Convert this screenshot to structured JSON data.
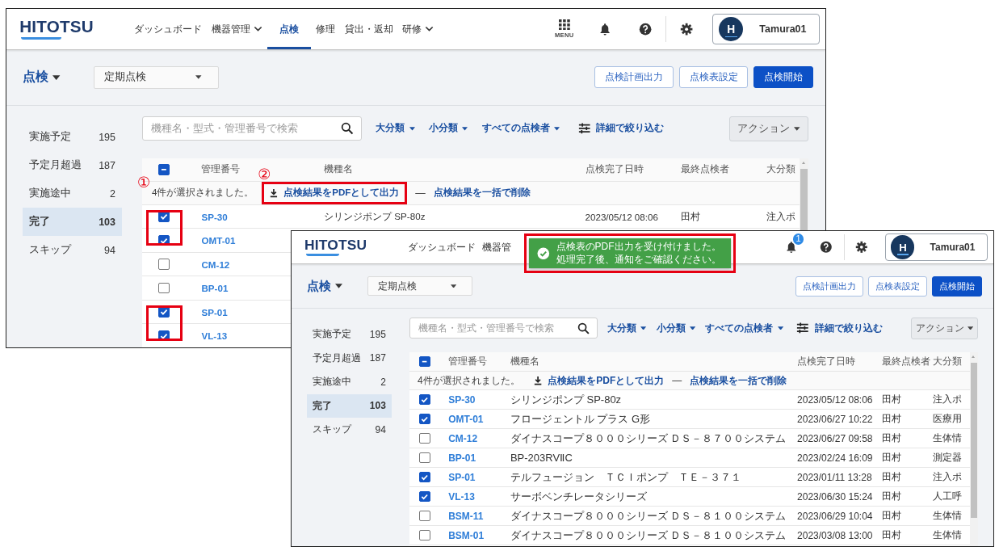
{
  "windows": [
    {
      "logo": "HITOTSU",
      "nav": [
        {
          "label": "ダッシュボード",
          "selected": false,
          "dropdown": false
        },
        {
          "label": "機器管理",
          "selected": false,
          "dropdown": true
        },
        {
          "label": "点検",
          "selected": true,
          "dropdown": false
        },
        {
          "label": "修理",
          "selected": false,
          "dropdown": false
        },
        {
          "label": "貸出・返却",
          "selected": false,
          "dropdown": false
        },
        {
          "label": "研修",
          "selected": false,
          "dropdown": true
        }
      ],
      "menu_label": "MENU",
      "user": {
        "avatar": "H",
        "name": "Tamura01"
      },
      "page_title": "点検",
      "type_select": "定期点検",
      "header_buttons": [
        {
          "label": "点検計画出力",
          "primary": false
        },
        {
          "label": "点検表設定",
          "primary": false
        },
        {
          "label": "点検開始",
          "primary": true
        }
      ],
      "sidebar": [
        {
          "label": "実施予定",
          "count": "195",
          "selected": false
        },
        {
          "label": "予定月超過",
          "count": "187",
          "selected": false
        },
        {
          "label": "実施途中",
          "count": "2",
          "selected": false
        },
        {
          "label": "完了",
          "count": "103",
          "selected": true
        },
        {
          "label": "スキップ",
          "count": "94",
          "selected": false
        }
      ],
      "search": {
        "placeholder": "機種名・型式・管理番号で検索"
      },
      "filters": [
        {
          "label": "大分類",
          "kind": "dropdown"
        },
        {
          "label": "小分類",
          "kind": "dropdown"
        },
        {
          "label": "すべての点検者",
          "kind": "dropdown"
        },
        {
          "label": "詳細で絞り込む",
          "kind": "detail"
        }
      ],
      "action_button": "アクション",
      "table": {
        "select_all_partial": true,
        "columns": [
          "管理番号",
          "機種名",
          "点検完了日時",
          "最終点検者",
          "大分類"
        ],
        "selection": {
          "text": "4件が選択されました。",
          "marker": "①",
          "pdf_action": {
            "label": "点検結果をPDFとして出力",
            "highlighted": true,
            "marker": "②"
          },
          "separator": "—",
          "delete_action": "点検結果を一括で削除"
        },
        "rows": [
          {
            "id": "SP-30",
            "name": "シリンジポンプ SP-80z",
            "date": "2023/05/12 08:06",
            "inspector": "田村",
            "category": "注入ポ",
            "checked": true,
            "highlighted": true
          },
          {
            "id": "OMT-01",
            "checked": true,
            "highlighted": true
          },
          {
            "id": "CM-12",
            "checked": false,
            "highlighted": false
          },
          {
            "id": "BP-01",
            "checked": false,
            "highlighted": false
          },
          {
            "id": "SP-01",
            "checked": true,
            "highlighted": true
          },
          {
            "id": "VL-13",
            "checked": true,
            "highlighted": true
          }
        ]
      }
    },
    {
      "logo": "HITOTSU",
      "nav": [
        {
          "label": "ダッシュボード",
          "selected": false,
          "dropdown": false
        },
        {
          "label": "機器管",
          "selected": false,
          "dropdown": false
        }
      ],
      "notification_badge": "1",
      "user": {
        "avatar": "H",
        "name": "Tamura01"
      },
      "page_title": "点検",
      "type_select": "定期点検",
      "header_buttons": [
        {
          "label": "点検計画出力",
          "primary": false
        },
        {
          "label": "点検表設定",
          "primary": false
        },
        {
          "label": "点検開始",
          "primary": true
        }
      ],
      "sidebar": [
        {
          "label": "実施予定",
          "count": "195",
          "selected": false
        },
        {
          "label": "予定月超過",
          "count": "187",
          "selected": false
        },
        {
          "label": "実施途中",
          "count": "2",
          "selected": false
        },
        {
          "label": "完了",
          "count": "103",
          "selected": true
        },
        {
          "label": "スキップ",
          "count": "94",
          "selected": false
        }
      ],
      "search": {
        "placeholder": "機種名・型式・管理番号で検索"
      },
      "filters": [
        {
          "label": "大分類",
          "kind": "dropdown"
        },
        {
          "label": "小分類",
          "kind": "dropdown"
        },
        {
          "label": "すべての点検者",
          "kind": "dropdown"
        },
        {
          "label": "詳細で絞り込む",
          "kind": "detail"
        }
      ],
      "action_button": "アクション",
      "table": {
        "select_all_partial": true,
        "columns": [
          "管理番号",
          "機種名",
          "点検完了日時",
          "最終点検者",
          "大分類"
        ],
        "selection": {
          "text": "4件が選択されました。",
          "pdf_action": {
            "label": "点検結果をPDFとして出力",
            "highlighted": false
          },
          "separator": "—",
          "delete_action": "点検結果を一括で削除"
        },
        "rows": [
          {
            "id": "SP-30",
            "name": "シリンジポンプ SP-80z",
            "date": "2023/05/12 08:06",
            "inspector": "田村",
            "category": "注入ポ",
            "checked": true,
            "highlighted": false
          },
          {
            "id": "OMT-01",
            "name": "フロージェントル プラス G形",
            "date": "2023/06/27 10:22",
            "inspector": "田村",
            "category": "医療用",
            "checked": true,
            "highlighted": false
          },
          {
            "id": "CM-12",
            "name": "ダイナスコープ８０００シリーズ ＤＳ－８７００システム",
            "date": "2023/06/27 09:58",
            "inspector": "田村",
            "category": "生体情",
            "checked": false,
            "highlighted": false
          },
          {
            "id": "BP-01",
            "name": "BP-203RVⅡC",
            "date": "2023/02/24 16:09",
            "inspector": "田村",
            "category": "測定器",
            "checked": false,
            "highlighted": false
          },
          {
            "id": "SP-01",
            "name": "テルフュージョン　ＴＣＩポンプ　ＴＥ－３７１",
            "date": "2023/01/11 13:28",
            "inspector": "田村",
            "category": "注入ポ",
            "checked": true,
            "highlighted": false
          },
          {
            "id": "VL-13",
            "name": "サーボベンチレータシリーズ",
            "date": "2023/06/30 15:24",
            "inspector": "田村",
            "category": "人工呼",
            "checked": true,
            "highlighted": false
          },
          {
            "id": "BSM-11",
            "name": "ダイナスコープ８０００シリーズ ＤＳ－８１００システム",
            "date": "2023/06/29 10:04",
            "inspector": "田村",
            "category": "生体情",
            "checked": false,
            "highlighted": false
          },
          {
            "id": "BSM-01",
            "name": "ダイナスコープ８０００シリーズ ＤＳ－８１００システム",
            "date": "2023/03/08 13:00",
            "inspector": "田村",
            "category": "生体情",
            "checked": false,
            "highlighted": false
          }
        ]
      },
      "toast": {
        "text": "点検表のPDF出力を受け付けました。処理完了後、通知をご確認ください。",
        "highlighted": true
      }
    }
  ]
}
